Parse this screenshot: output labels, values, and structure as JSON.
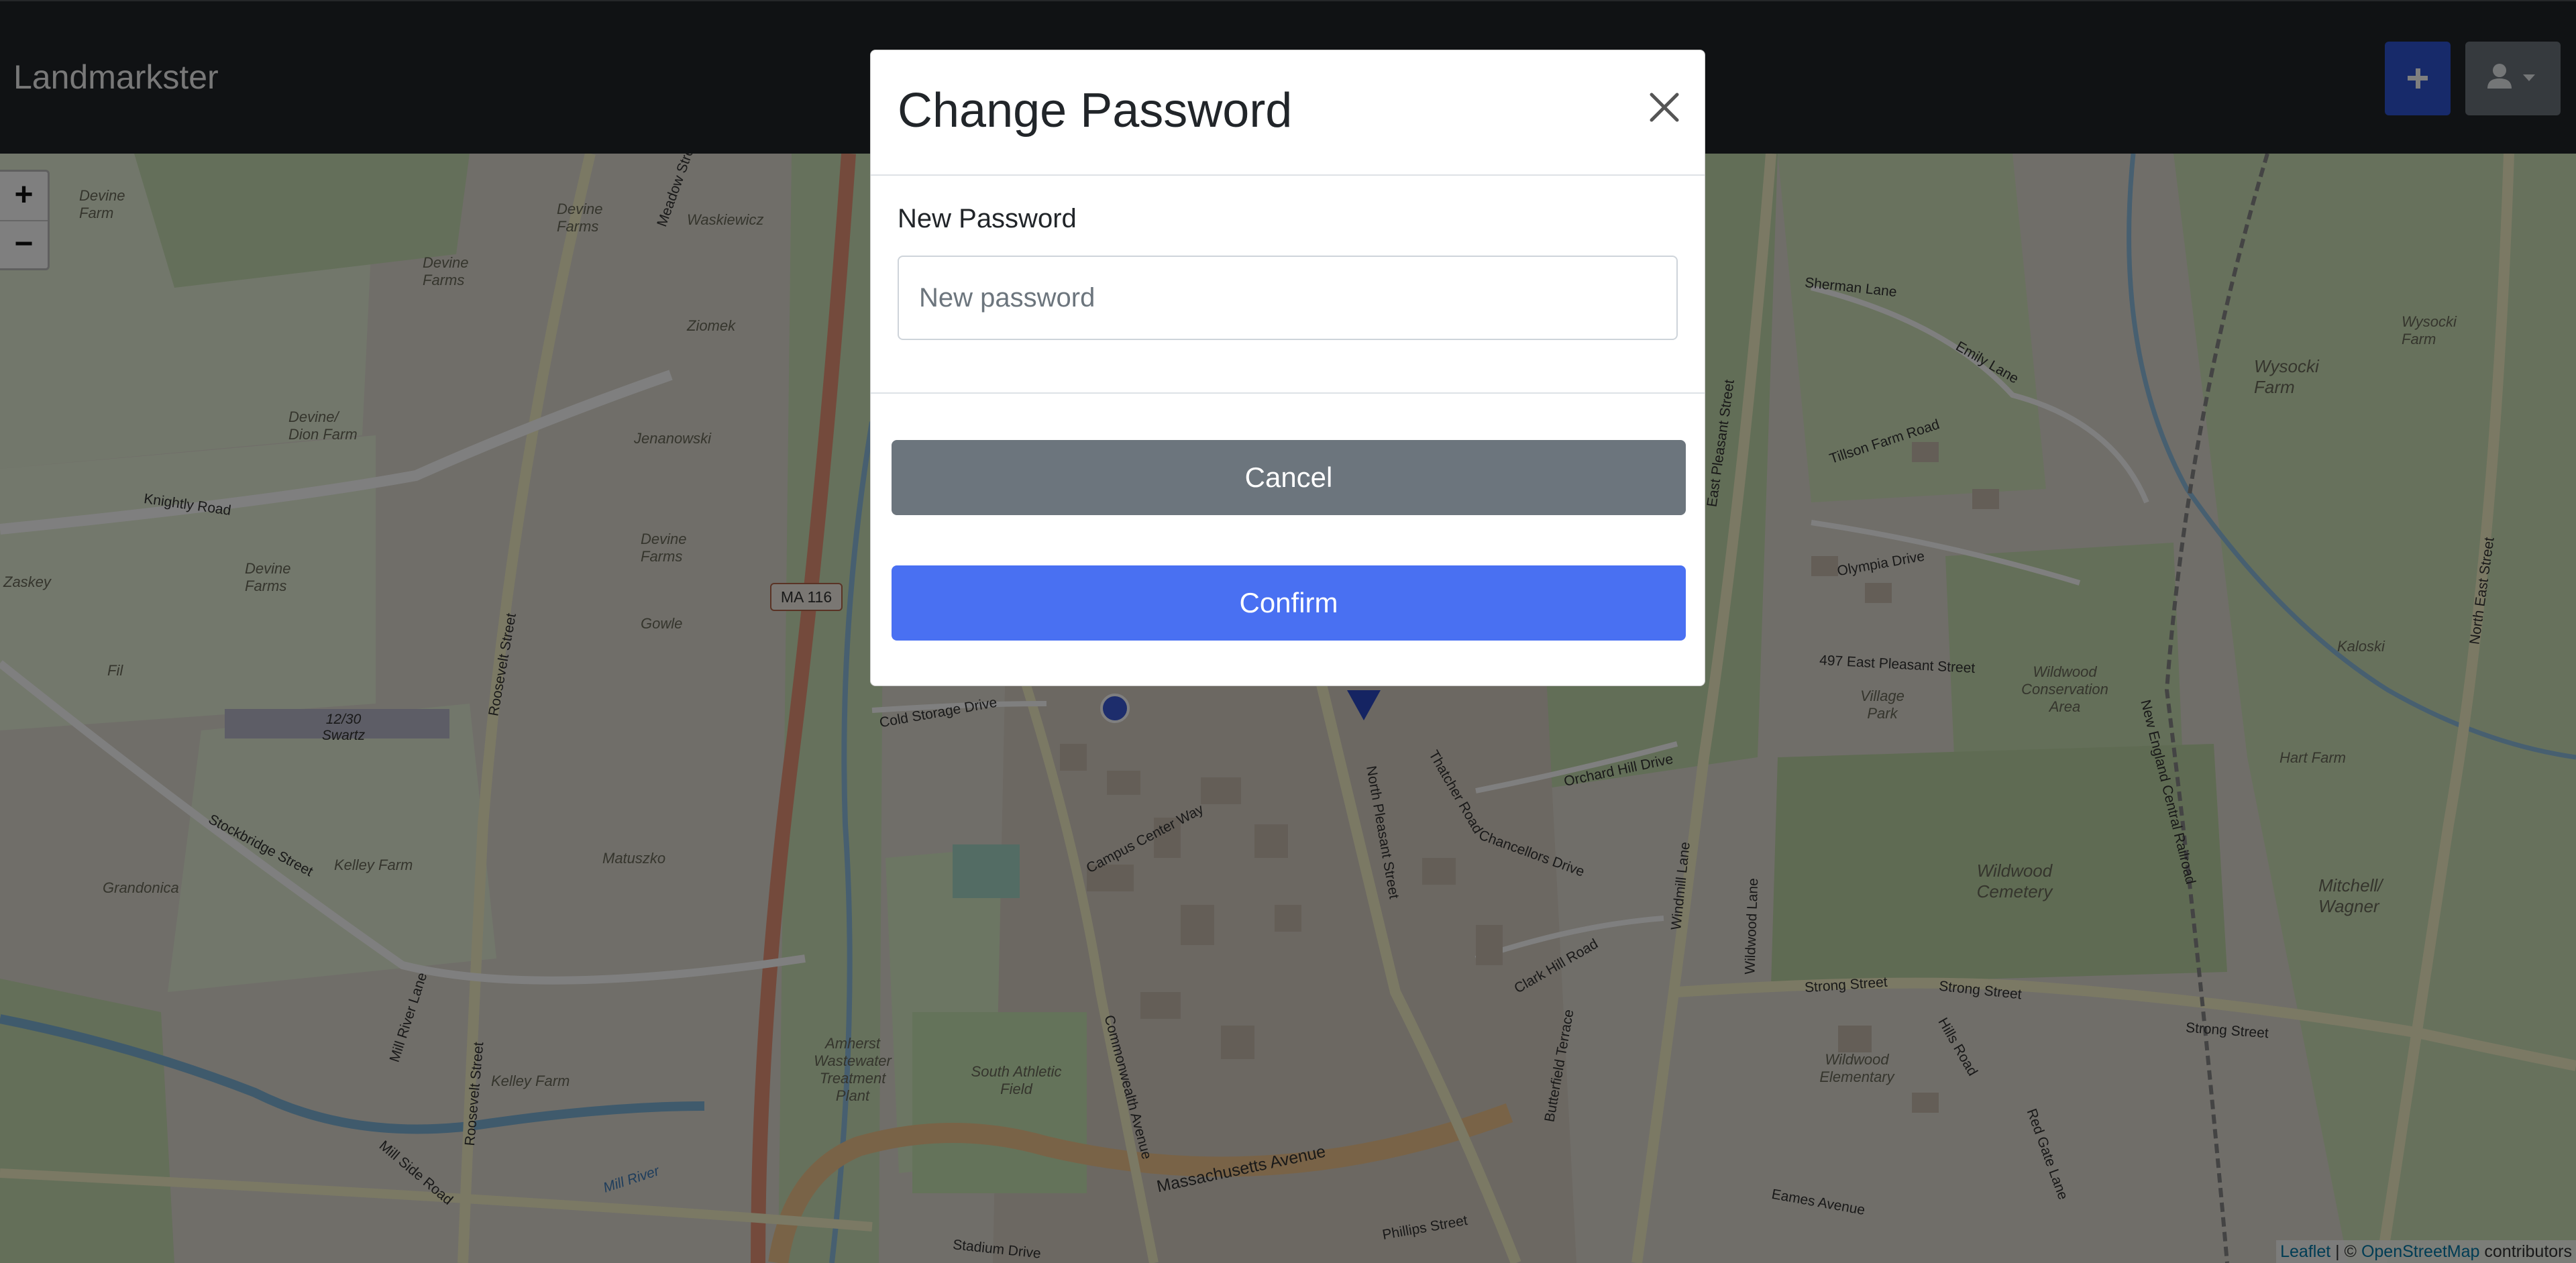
{
  "navbar": {
    "brand": "Landmarkster",
    "add_button_icon": "plus-icon",
    "user_menu_icon": "user-icon",
    "accent_color": "#2f55d4"
  },
  "map": {
    "zoom_in": "+",
    "zoom_out": "−",
    "route_shield": "MA 116",
    "attribution": {
      "leaflet": "Leaflet",
      "separator": " | © ",
      "osm": "OpenStreetMap",
      "suffix": " contributors"
    },
    "place_labels": [
      "Devine Farm",
      "Devine Farms",
      "Waskiewicz",
      "Devine Farms",
      "Ziomek",
      "Devine/ Dion Farm",
      "Jenanowski",
      "Devine Farms",
      "Gowle",
      "Devine Farms",
      "Zaskey",
      "Fil",
      "Kelley Farm",
      "Grandonica",
      "Matuszko",
      "Kelley Farm",
      "Amherst Wastewater Treatment Plant",
      "South Athletic Field",
      "Wildwood Conservation Area",
      "Village Park",
      "Wildwood Cemetery",
      "Wildwood Elementary",
      "Wysocki Farm",
      "Wysocki Farm",
      "Hart Farm",
      "Mitchell/ Wagner",
      "Kaloski"
    ],
    "road_labels": [
      "Knightly Road",
      "Roosevelt Street",
      "Stockbridge Street",
      "Mill River Lane",
      "Mill Side Road",
      "Roosevelt Street",
      "Mill River",
      "Cold Storage Drive",
      "Campus Center Way",
      "Commonwealth Avenue",
      "Massachusetts Avenue",
      "North Pleasant Street",
      "Thatcher Road",
      "Chancellors Drive",
      "Orchard Hill Drive",
      "Clark Hill Road",
      "Butterfield Terrace",
      "East Pleasant Street",
      "Strong Street",
      "Strong Street",
      "Strong Street",
      "Sherman Lane",
      "Emily Lane",
      "Tillson Farm Road",
      "Olympia Drive",
      "497 East Pleasant Street",
      "Hills Road",
      "Red Gate Lane",
      "Eames Avenue",
      "Phillips Street",
      "Stadium Drive",
      "North East Street",
      "Windmill Lane",
      "Wildwood Lane",
      "New England Central Railroad",
      "12/30 Swartz",
      "Meadow Street"
    ]
  },
  "modal": {
    "title": "Change Password",
    "close_icon": "close-icon",
    "field_label": "New Password",
    "input_value": "",
    "input_placeholder": "New password",
    "cancel_label": "Cancel",
    "confirm_label": "Confirm",
    "cancel_color": "#6c757d",
    "confirm_color": "#4970f2"
  }
}
